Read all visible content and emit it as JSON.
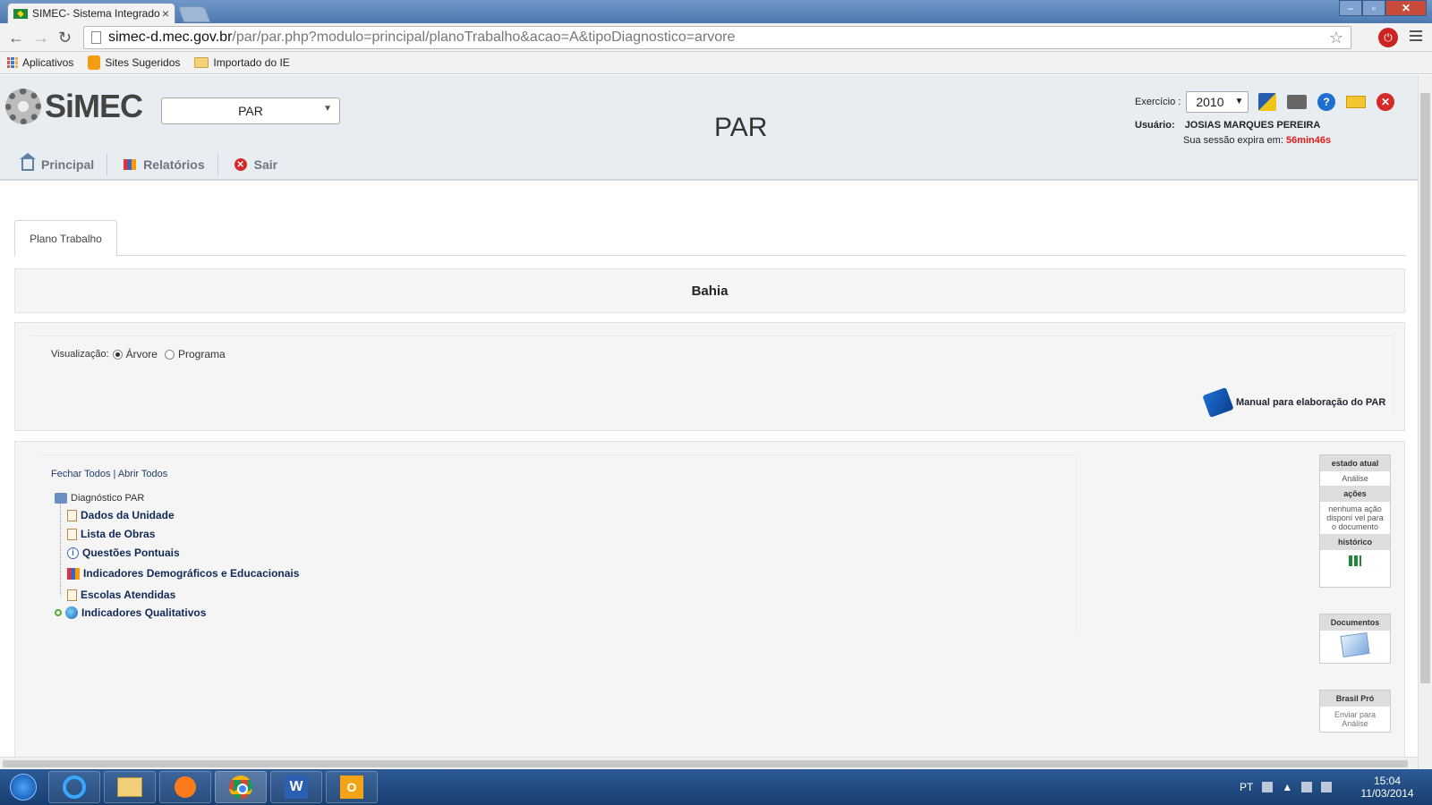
{
  "browser": {
    "tab_title": "SIMEC- Sistema Integrado",
    "tab_close": "×",
    "url_host": "simec-d.mec.gov.br",
    "url_path": "/par/par.php?modulo=principal/planoTrabalho&acao=A&tipoDiagnostico=arvore",
    "bookmarks": [
      "Aplicativos",
      "Sites Sugeridos",
      "Importado do IE"
    ]
  },
  "header": {
    "logo": "SiMEC",
    "module_selected": "PAR",
    "title": "PAR",
    "exercicio_label": "Exercício :",
    "exercicio_value": "2010",
    "usuario_label": "Usuário:",
    "usuario_value": "JOSIAS MARQUES PEREIRA",
    "session_label": "Sua sessão expira em:",
    "session_time": "56min46s",
    "nav": [
      "Principal",
      "Relatórios",
      "Sair"
    ]
  },
  "tabs": [
    "Plano Trabalho"
  ],
  "state_title": "Bahia",
  "visualizacao": {
    "label": "Visualização:",
    "options": [
      "Árvore",
      "Programa"
    ],
    "selected": "Árvore"
  },
  "manual_link": "Manual para elaboração do PAR",
  "tree": {
    "fechar_todos": "Fechar Todos",
    "separator": "|",
    "abrir_todos": "Abrir Todos",
    "root": "Diagnóstico PAR",
    "items": [
      "Dados da Unidade",
      "Lista de Obras",
      "Questões Pontuais",
      "Indicadores Demográficos e Educacionais",
      "Escolas Atendidas",
      "Indicadores Qualitativos"
    ]
  },
  "workflow": {
    "estado_label": "estado atual",
    "estado_value": "Análise",
    "acoes_label": "ações",
    "acoes_value": "nenhuma ação disponí vel para o documento",
    "historico_label": "histórico",
    "documentos_label": "Documentos",
    "brasil_pro_label": "Brasil Pró",
    "brasil_pro_value": "Enviar para Análise"
  },
  "taskbar": {
    "lang": "PT",
    "time": "15:04",
    "date": "11/03/2014"
  }
}
